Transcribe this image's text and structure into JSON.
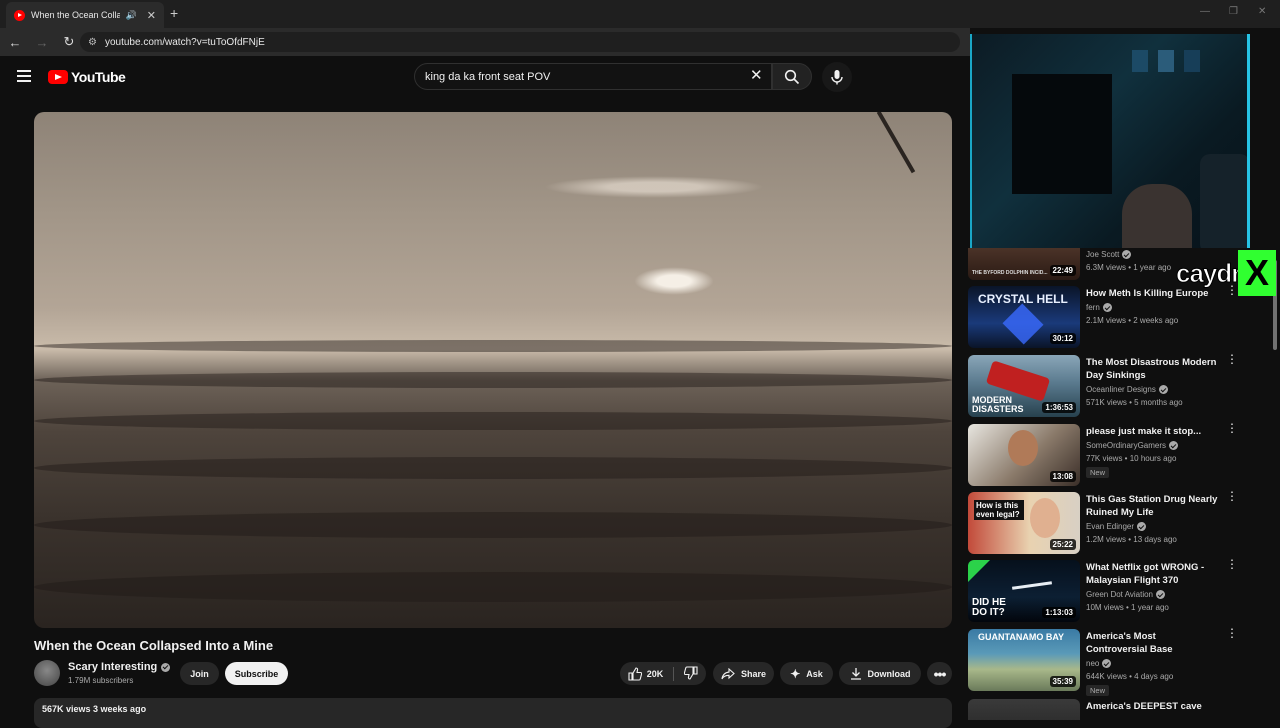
{
  "browser": {
    "tab_title": "When the Ocean Collapsed Into a Mine",
    "url": "youtube.com/watch?v=tuToOfdFNjE"
  },
  "header": {
    "logo_text": "YouTube",
    "search_value": "king da ka front seat  POV"
  },
  "video": {
    "title": "When the Ocean Collapsed Into a Mine",
    "channel": "Scary Interesting",
    "subscribers": "1.79M subscribers",
    "join_label": "Join",
    "subscribe_label": "Subscribe",
    "likes": "20K",
    "share_label": "Share",
    "ask_label": "Ask",
    "download_label": "Download",
    "views_date": "567K views  3 weeks ago"
  },
  "overlay": {
    "streamer_tag": "caydr",
    "tag_mark": "X",
    "tag_color": "#30ff30"
  },
  "recommendations": [
    {
      "title": "",
      "channel": "Joe Scott",
      "verified": true,
      "meta": "6.3M views • 1 year ago",
      "duration": "22:49",
      "thumb_text": "THE BYFORD DOLPHIN INCID...",
      "new": ""
    },
    {
      "title": "How Meth Is Killing Europe",
      "channel": "fern",
      "verified": true,
      "meta": "2.1M views • 2 weeks ago",
      "duration": "30:12",
      "thumb_text": "CRYSTAL HELL",
      "new": ""
    },
    {
      "title": "The Most Disastrous Modern Day Sinkings",
      "channel": "Oceanliner Designs",
      "verified": true,
      "meta": "571K views • 5 months ago",
      "duration": "1:36:53",
      "thumb_text": "MODERN DISASTERS",
      "new": ""
    },
    {
      "title": "please just make it stop...",
      "channel": "SomeOrdinaryGamers",
      "verified": true,
      "meta": "77K views • 10 hours ago",
      "duration": "13:08",
      "thumb_text": "",
      "new": "New"
    },
    {
      "title": "This Gas Station Drug Nearly Ruined My Life",
      "channel": "Evan Edinger",
      "verified": true,
      "meta": "1.2M views • 13 days ago",
      "duration": "25:22",
      "thumb_text": "How is this even legal?",
      "new": ""
    },
    {
      "title": "What Netflix got WRONG - Malaysian Flight 370",
      "channel": "Green Dot Aviation",
      "verified": true,
      "meta": "10M views • 1 year ago",
      "duration": "1:13:03",
      "thumb_text": "DID HE DO IT?",
      "new": ""
    },
    {
      "title": "America's Most Controversial Base",
      "channel": "neo",
      "verified": true,
      "meta": "644K views • 4 days ago",
      "duration": "35:39",
      "thumb_text": "GUANTANAMO BAY",
      "new": "New"
    },
    {
      "title": "America's DEEPEST cave",
      "channel": "",
      "verified": false,
      "meta": "",
      "duration": "",
      "thumb_text": "",
      "new": ""
    }
  ],
  "colors": {
    "bg": "#0f0f0f",
    "accent": "#ff0000",
    "webcam_border": "#27c4e6"
  }
}
